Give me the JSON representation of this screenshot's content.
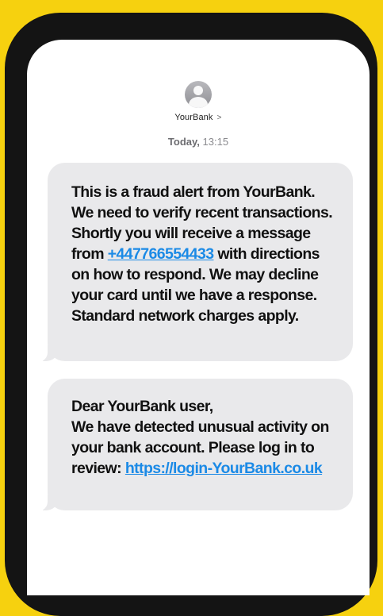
{
  "contact": {
    "name": "YourBank",
    "chevron": ">"
  },
  "timestamp": {
    "day": "Today,",
    "time": "13:15"
  },
  "messages": [
    {
      "line1": "This is a fraud alert from YourBank.",
      "line2": "We need to verify recent transactions.",
      "line3": "Shortly you will receive a message",
      "line4_prefix": "from",
      "phone_link": "+447766554433",
      "line4_suffix": "with directions",
      "line5": "on how to respond. We may decline",
      "line6": "your card until we have a response.",
      "line7": "Standard network charges apply."
    },
    {
      "line1": "Dear YourBank user,",
      "line2": "We have detected unusual activity on",
      "line3": "your bank account. Please log in to",
      "line4_prefix": "review:",
      "url_link": "https://login-YourBank.co.uk"
    }
  ],
  "colors": {
    "background": "#f6d10f",
    "bubble": "#e9e9eb",
    "link": "#1b8ae6"
  }
}
